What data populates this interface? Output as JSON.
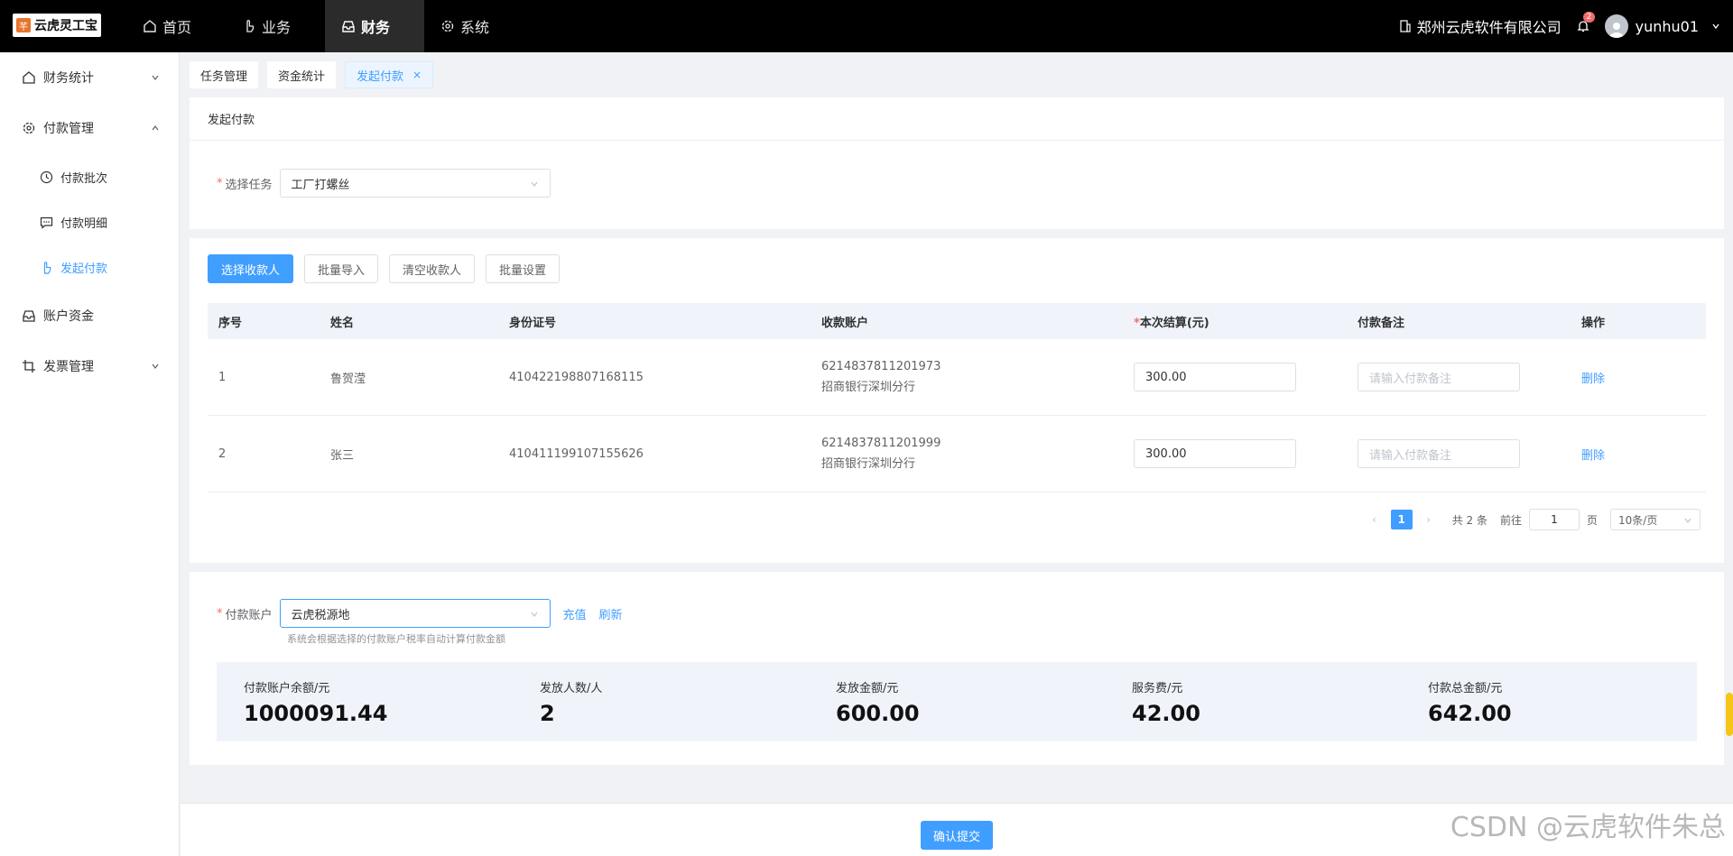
{
  "app": {
    "logo_text": "云虎灵工宝",
    "logo_mark": "芊"
  },
  "topnav": [
    {
      "label": "首页",
      "icon": "home-icon"
    },
    {
      "label": "业务",
      "icon": "hand-pointer-icon"
    },
    {
      "label": "财务",
      "icon": "inbox-icon"
    },
    {
      "label": "系统",
      "icon": "gear-icon"
    }
  ],
  "header": {
    "company": "郑州云虎软件有限公司",
    "notification_count": "2",
    "username": "yunhu01"
  },
  "sidebar": {
    "items": [
      {
        "label": "财务统计"
      },
      {
        "label": "付款管理"
      },
      {
        "label": "付款批次"
      },
      {
        "label": "付款明细"
      },
      {
        "label": "发起付款"
      },
      {
        "label": "账户资金"
      },
      {
        "label": "发票管理"
      }
    ]
  },
  "tabs": [
    {
      "label": "任务管理"
    },
    {
      "label": "资金统计"
    },
    {
      "label": "发起付款",
      "close": "×"
    }
  ],
  "task_panel": {
    "title": "发起付款",
    "label": "选择任务",
    "required": "*",
    "value": "工厂打螺丝"
  },
  "toolbar": {
    "select_payee": "选择收款人",
    "batch_import": "批量导入",
    "clear_payee": "清空收款人",
    "batch_settings": "批量设置"
  },
  "table": {
    "headers": {
      "index": "序号",
      "name": "姓名",
      "id_number": "身份证号",
      "account": "收款账户",
      "amount_required": "*",
      "amount": "本次结算(元)",
      "remark": "付款备注",
      "action": "操作"
    },
    "rows": [
      {
        "index": "1",
        "name": "鲁贺滢",
        "id_number": "410422198807168115",
        "account_no": "6214837811201973",
        "bank": "招商银行深圳分行",
        "amount": "300.00",
        "remark_placeholder": "请输入付款备注",
        "action": "删除"
      },
      {
        "index": "2",
        "name": "张三",
        "id_number": "410411199107155626",
        "account_no": "6214837811201999",
        "bank": "招商银行深圳分行",
        "amount": "300.00",
        "remark_placeholder": "请输入付款备注",
        "action": "删除"
      }
    ]
  },
  "pagination": {
    "current": "1",
    "total": "共 2 条",
    "goto_label": "前往",
    "goto_value": "1",
    "page_unit": "页",
    "page_size": "10条/页"
  },
  "pay_account": {
    "label": "付款账户",
    "required": "*",
    "value": "云虎税源地",
    "recharge": "充值",
    "refresh": "刷新",
    "hint": "系统会根据选择的付款账户税率自动计算付款金额"
  },
  "stats": [
    {
      "label": "付款账户余额/元",
      "value": "1000091.44"
    },
    {
      "label": "发放人数/人",
      "value": "2"
    },
    {
      "label": "发放金额/元",
      "value": "600.00"
    },
    {
      "label": "服务费/元",
      "value": "42.00"
    },
    {
      "label": "付款总金额/元",
      "value": "642.00"
    }
  ],
  "footer": {
    "submit": "确认提交"
  },
  "watermark": "CSDN @云虎软件朱总"
}
